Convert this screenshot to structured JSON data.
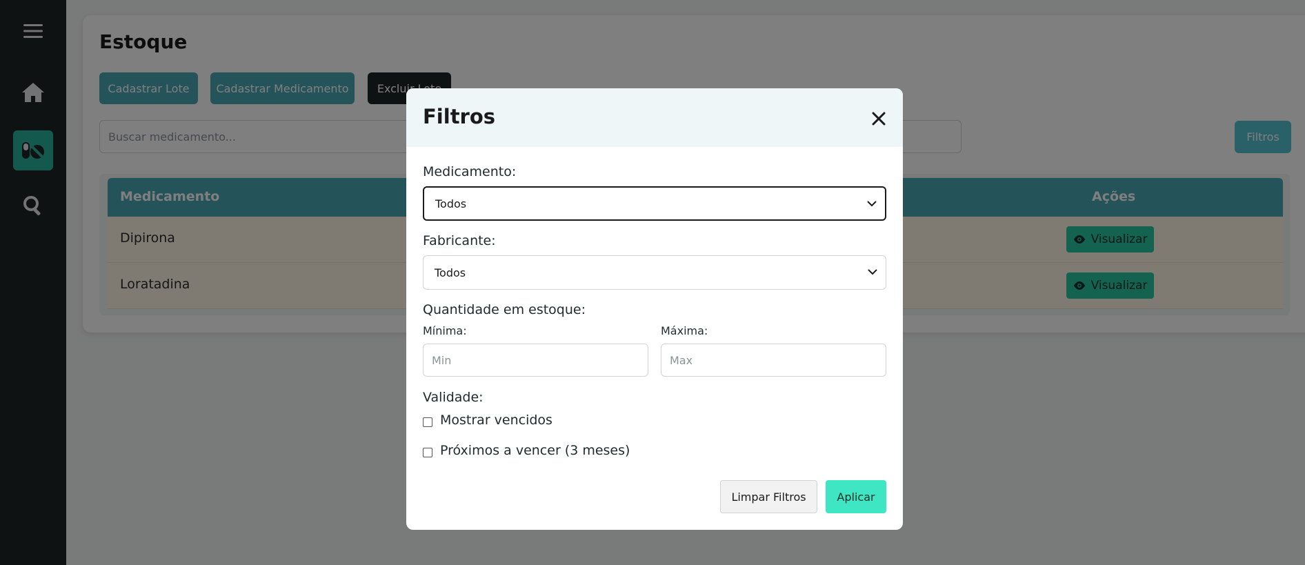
{
  "sidebar": {
    "items": [
      {
        "icon": "menu-icon"
      },
      {
        "icon": "home-icon"
      },
      {
        "icon": "pills-icon",
        "active": true
      },
      {
        "icon": "search-icon"
      }
    ],
    "accent": "#27b39a"
  },
  "page": {
    "title": "Estoque",
    "buttons": {
      "cadastrar_lote": "Cadastrar Lote",
      "cadastrar_medicamento": "Cadastrar Medicamento",
      "excluir_lote": "Excluir Lote"
    },
    "search_placeholder": "Buscar medicamento...",
    "filtros_label": "Filtros"
  },
  "table": {
    "headers": {
      "medicamento": "Medicamento",
      "acoes": "Ações"
    },
    "rows": [
      {
        "name": "Dipirona",
        "action": "Visualizar"
      },
      {
        "name": "Loratadina",
        "action": "Visualizar"
      }
    ]
  },
  "modal": {
    "title": "Filtros",
    "medicamento_label": "Medicamento:",
    "medicamento_value": "Todos",
    "fabricante_label": "Fabricante:",
    "fabricante_value": "Todos",
    "quantidade_label": "Quantidade em estoque:",
    "minima_label": "Mínima:",
    "minima_placeholder": "Min",
    "maxima_label": "Máxima:",
    "maxima_placeholder": "Max",
    "validade_label": "Validade:",
    "vencidos_label": "Mostrar vencidos",
    "vencidos_checked": false,
    "proximos_label": "Próximos a vencer (3 meses)",
    "proximos_checked": false,
    "limpar_label": "Limpar Filtros",
    "aplicar_label": "Aplicar"
  }
}
